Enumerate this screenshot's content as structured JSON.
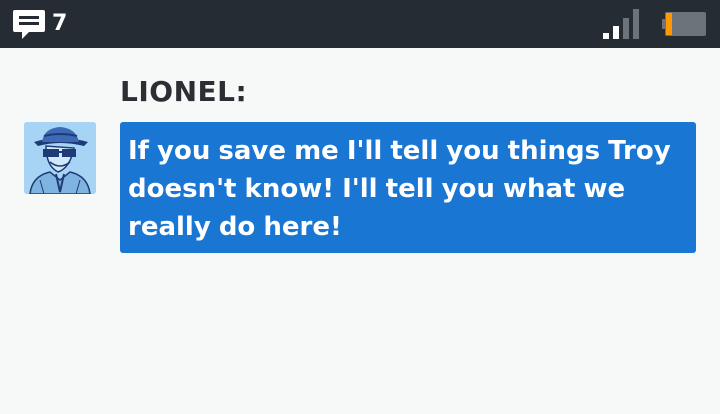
{
  "status_bar": {
    "message_count": "7",
    "icons": {
      "messages": "chat-bubble-icon",
      "signal": "signal-strength-icon",
      "battery": "battery-low-icon"
    },
    "colors": {
      "background": "#262c33",
      "battery_level": "#ff9800"
    },
    "battery_level": 0.15,
    "signal_bars_active": 2,
    "signal_bars_total": 4
  },
  "conversation": {
    "sender": "LIONEL:",
    "message": "If you save me I'll tell you things Troy doesn't know! I'll tell you what we really do here!",
    "avatar_icon": "man-with-hat-and-glasses-avatar",
    "colors": {
      "bubble": "#1976d2",
      "avatar_bg": "#a7d4f4"
    }
  }
}
